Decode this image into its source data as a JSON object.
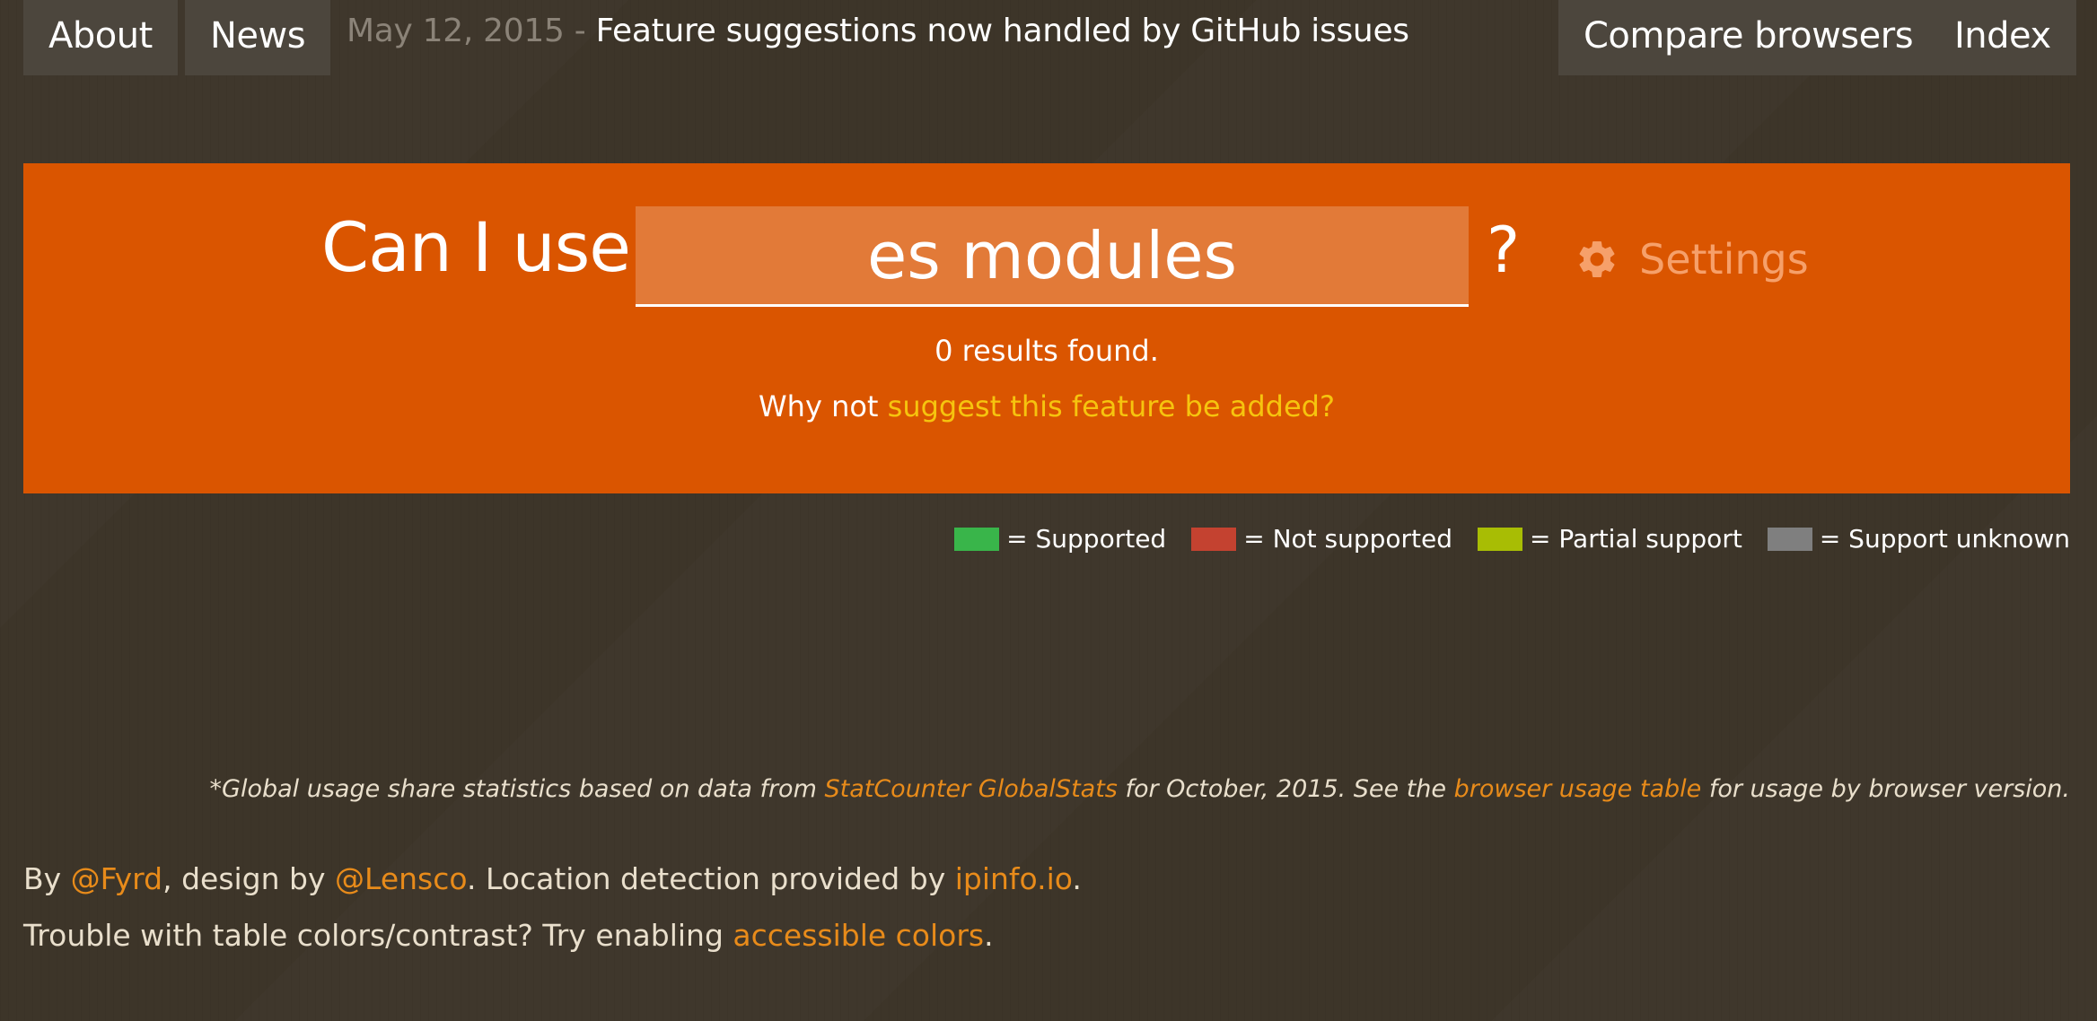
{
  "nav": {
    "left": [
      "About",
      "News"
    ],
    "right": [
      "Compare browsers",
      "Index"
    ]
  },
  "news": {
    "date": "May 12, 2015",
    "separator": " - ",
    "headline": "Feature suggestions now handled by GitHub issues"
  },
  "search": {
    "prefix": "Can I use",
    "value": "es modules",
    "suffix": "?",
    "settings_label": "Settings",
    "settings_icon": "gear-icon",
    "results_text": "0 results found.",
    "suggest_prefix": "Why not ",
    "suggest_link": "suggest this feature be added?"
  },
  "legend": [
    {
      "color": "#39b54a",
      "label": "= Supported"
    },
    {
      "color": "#c44230",
      "label": "= Not supported"
    },
    {
      "color": "#a8bd04",
      "label": "= Partial support"
    },
    {
      "color": "#7f7f7f",
      "label": "= Support unknown"
    }
  ],
  "usage_note": {
    "prefix": "*Global usage share statistics based on data from ",
    "link1": "StatCounter GlobalStats",
    "middle": " for October, 2015. See the ",
    "link2": "browser usage table",
    "suffix": " for usage by browser version."
  },
  "footer": {
    "line1": {
      "by": "By ",
      "author": "@Fyrd",
      "design_by": ", design by ",
      "designer": "@Lensco",
      "location_text": ". Location detection provided by ",
      "location_link": "ipinfo.io",
      "end": "."
    },
    "line2": {
      "text": "Trouble with table colors/contrast? Try enabling ",
      "link": "accessible colors",
      "end": "."
    }
  },
  "colors": {
    "background": "#3d3529",
    "hero": "#da5500",
    "nav_button": "#4c463d",
    "link": "#e88b1a",
    "suggest_link": "#f6c40e"
  }
}
